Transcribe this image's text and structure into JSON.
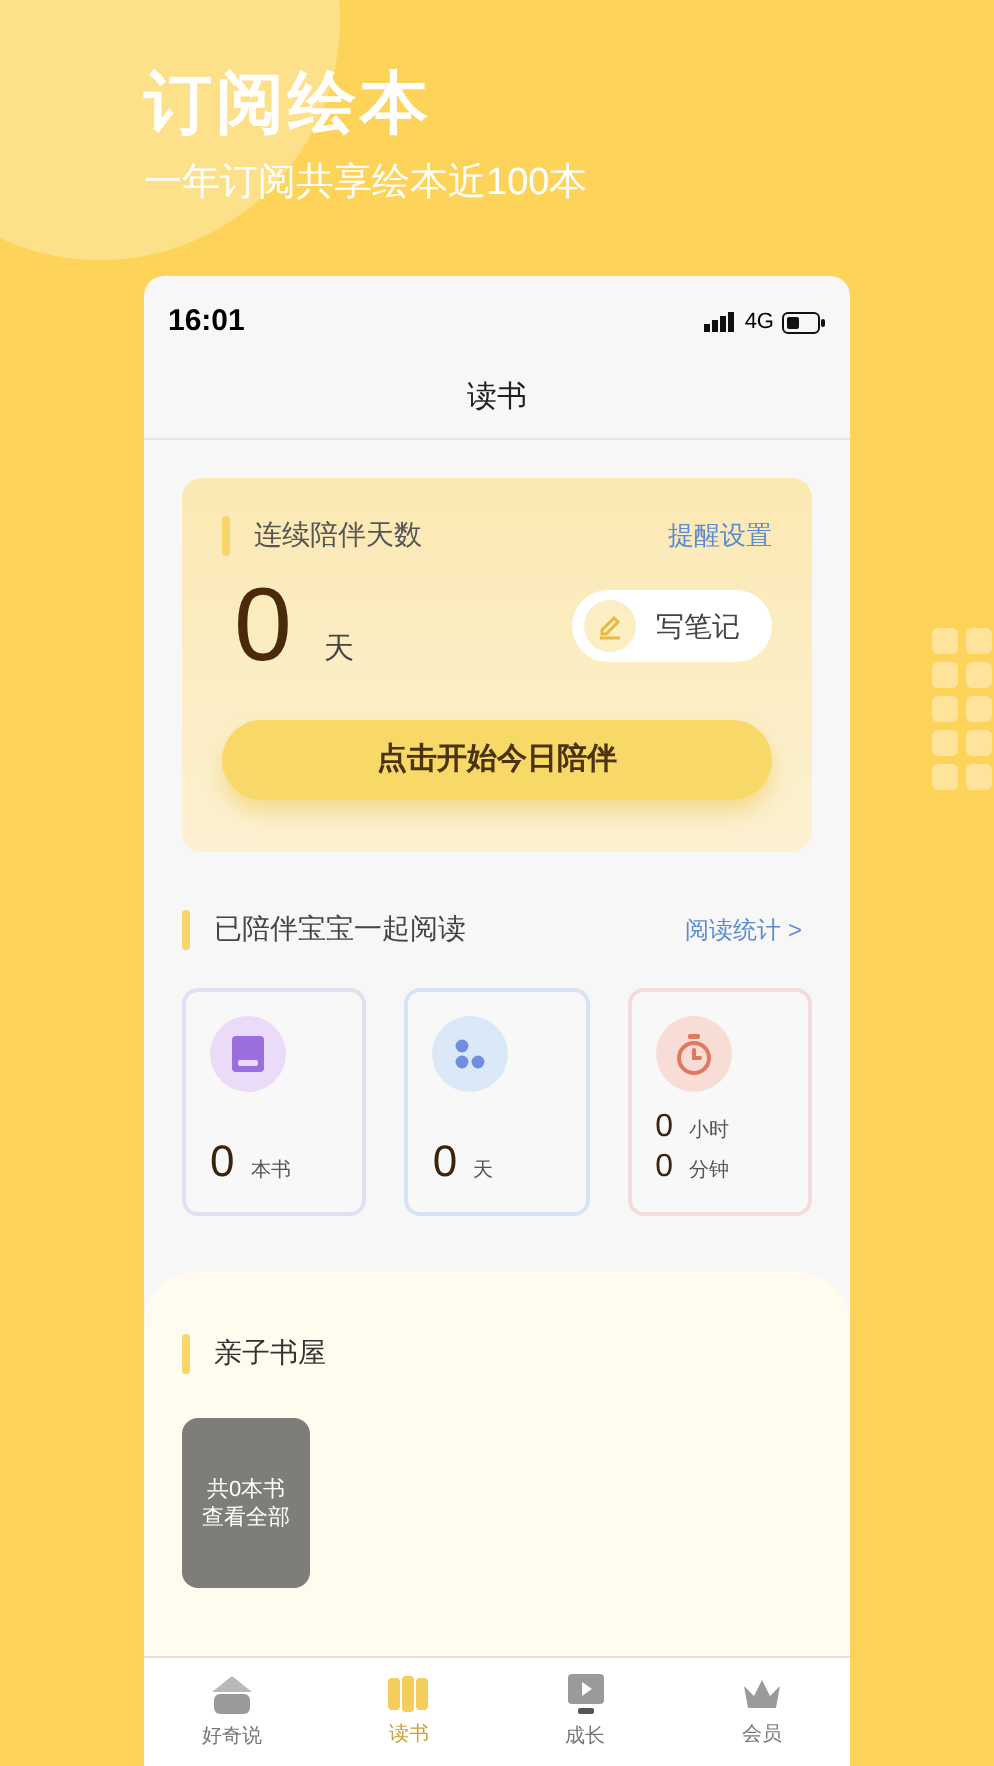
{
  "promo": {
    "title": "订阅绘本",
    "subtitle": "一年订阅共享绘本近100本"
  },
  "status_bar": {
    "time": "16:01",
    "network": "4G"
  },
  "nav_bar": {
    "title": "读书"
  },
  "streak_card": {
    "label": "连续陪伴天数",
    "link": "提醒设置",
    "count": "0",
    "unit": "天",
    "note_button": "写笔记",
    "start_button": "点击开始今日陪伴"
  },
  "reading_section": {
    "title": "已陪伴宝宝一起阅读",
    "link": "阅读统计 >"
  },
  "stats": [
    {
      "kind": "books",
      "lines": [
        {
          "value": "0",
          "unit": "本书"
        }
      ]
    },
    {
      "kind": "days",
      "lines": [
        {
          "value": "0",
          "unit": "天"
        }
      ]
    },
    {
      "kind": "time",
      "lines": [
        {
          "value": "0",
          "unit": "小时"
        },
        {
          "value": "0",
          "unit": "分钟"
        }
      ]
    }
  ],
  "bookshelf": {
    "title": "亲子书屋",
    "tile_lines": [
      "共0本书",
      "查看全部"
    ]
  },
  "tab_bar": [
    {
      "label": "好奇说",
      "kind": "home",
      "selected": false
    },
    {
      "label": "读书",
      "kind": "book",
      "selected": true
    },
    {
      "label": "成长",
      "kind": "video",
      "selected": false
    },
    {
      "label": "会员",
      "kind": "member",
      "selected": false
    }
  ]
}
